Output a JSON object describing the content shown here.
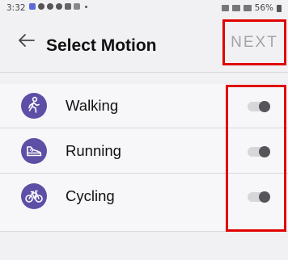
{
  "status_bar": {
    "time": "3:32",
    "battery": "56%"
  },
  "header": {
    "title": "Select Motion",
    "next_label": "NEXT"
  },
  "motions": [
    {
      "label": "Walking",
      "icon": "walking-icon",
      "enabled": false
    },
    {
      "label": "Running",
      "icon": "running-shoe-icon",
      "enabled": false
    },
    {
      "label": "Cycling",
      "icon": "bicycle-icon",
      "enabled": false
    }
  ],
  "colors": {
    "icon_background": "#5d4ea6",
    "highlight": "#e00000",
    "next_text": "#a3a3a8"
  }
}
